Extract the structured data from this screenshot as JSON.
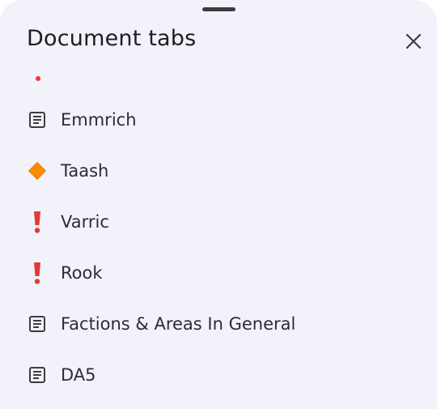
{
  "sheet": {
    "title": "Document tabs",
    "close_icon": "close-icon"
  },
  "tabs": [
    {
      "label": "Emmrich",
      "icon": "document-icon"
    },
    {
      "label": "Taash",
      "icon": "orange-diamond-emoji"
    },
    {
      "label": "Varric",
      "icon": "red-exclamation-emoji"
    },
    {
      "label": "Rook",
      "icon": "red-exclamation-emoji"
    },
    {
      "label": "Factions & Areas In General",
      "icon": "document-icon"
    },
    {
      "label": "DA5",
      "icon": "document-icon"
    }
  ],
  "colors": {
    "sheet_background": "#f2f2fb",
    "text": "#2b2d33",
    "accent_red": "#e53935",
    "accent_orange": "#f57c00"
  }
}
